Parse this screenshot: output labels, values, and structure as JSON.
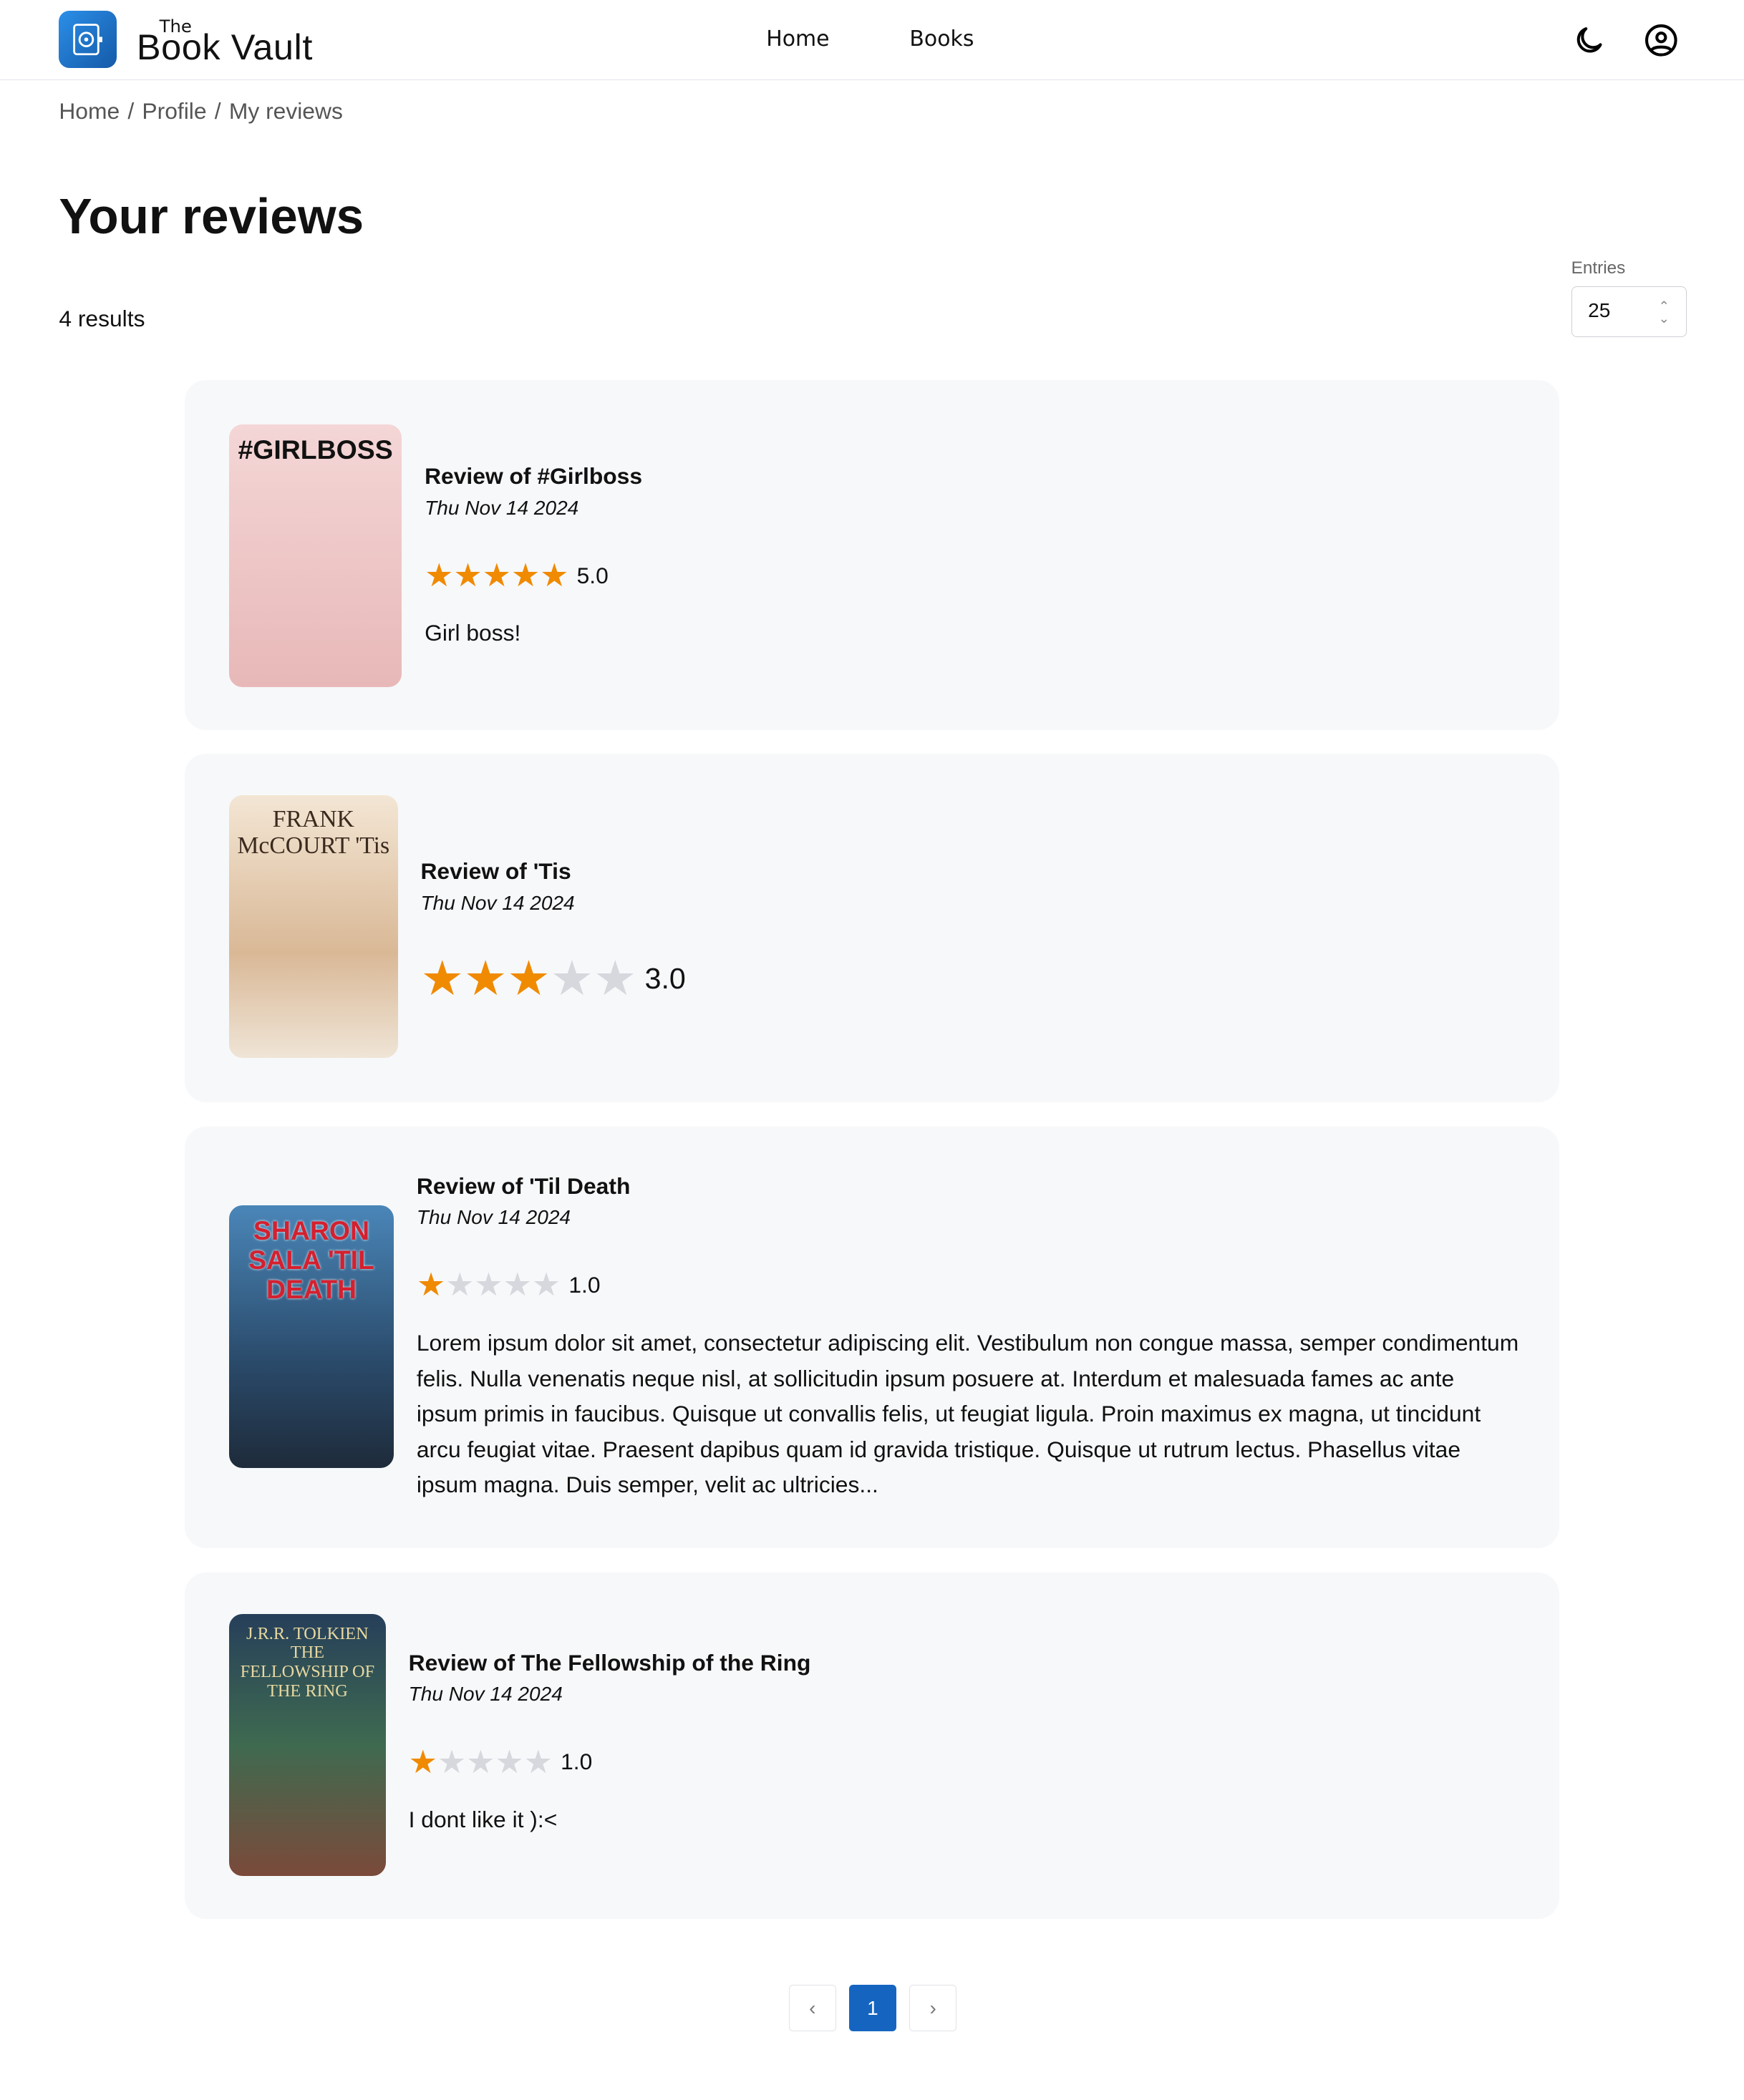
{
  "header": {
    "brand_small": "The",
    "brand": "Book Vault",
    "nav": [
      "Home",
      "Books"
    ]
  },
  "breadcrumb": [
    "Home",
    "Profile",
    "My reviews"
  ],
  "page_title": "Your reviews",
  "results": "4 results",
  "entries": {
    "label": "Entries",
    "value": "25"
  },
  "colors": {
    "accent": "#1565c0",
    "star": "#f08a00",
    "card": "#f7f8fa"
  },
  "reviews": [
    {
      "title": "Review of #Girlboss",
      "date": "Thu Nov 14 2024",
      "rating": 5,
      "rating_text": "5.0",
      "text": "Girl boss!",
      "cover": "#GIRLBOSS"
    },
    {
      "title": "Review of 'Tis",
      "date": "Thu Nov 14 2024",
      "rating": 3,
      "rating_text": "3.0",
      "text": "",
      "cover": "FRANK McCOURT 'Tis"
    },
    {
      "title": "Review of 'Til Death",
      "date": "Thu Nov 14 2024",
      "rating": 1,
      "rating_text": "1.0",
      "text": "Lorem ipsum dolor sit amet, consectetur adipiscing elit. Vestibulum non congue massa, semper condimentum felis. Nulla venenatis neque nisl, at sollicitudin ipsum posuere at. Interdum et malesuada fames ac ante ipsum primis in faucibus. Quisque ut convallis felis, ut feugiat ligula. Proin maximus ex magna, ut tincidunt arcu feugiat vitae. Praesent dapibus quam id gravida tristique. Quisque ut rutrum lectus. Phasellus vitae ipsum magna. Duis semper, velit ac ultricies...",
      "cover": "SHARON SALA 'TIL DEATH"
    },
    {
      "title": "Review of The Fellowship of the Ring",
      "date": "Thu Nov 14 2024",
      "rating": 1,
      "rating_text": "1.0",
      "text": "I dont like it ):<",
      "cover": "J.R.R. TOLKIEN THE FELLOWSHIP OF THE RING"
    }
  ],
  "pagination": {
    "current": "1",
    "prev": "‹",
    "next": "›"
  }
}
